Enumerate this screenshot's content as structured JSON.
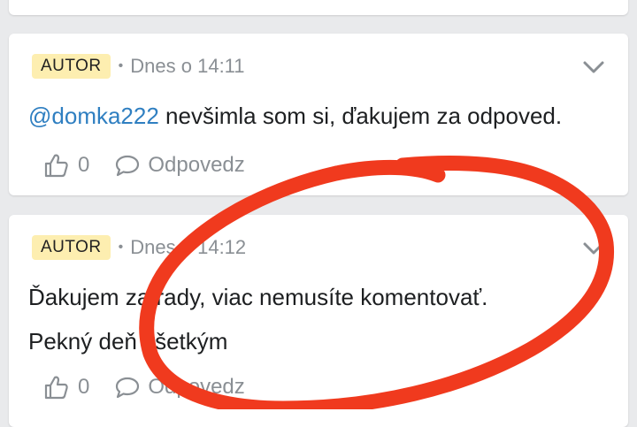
{
  "comments": [
    {
      "badge": "AUTOR",
      "separator": "•",
      "time": "Dnes o 14:11",
      "mention": "@domka222",
      "text": " nevšimla som si, ďakujem za odpoved.",
      "likes": "0",
      "reply_label": "Odpovedz"
    },
    {
      "badge": "AUTOR",
      "separator": "•",
      "time": "Dnes o 14:12",
      "line1": "Ďakujem za rady, viac nemusíte komentovať.",
      "line2": "Pekný deň všetkým",
      "likes": "0",
      "reply_label": "Odpovedz"
    }
  ],
  "icons": {
    "like": "thumbs-up-icon",
    "reply": "speech-bubble-icon",
    "menu": "chevron-down-icon"
  },
  "colors": {
    "badge_bg": "#fdeeb0",
    "mention": "#2f7fc1",
    "annotation": "#f03a1e"
  }
}
